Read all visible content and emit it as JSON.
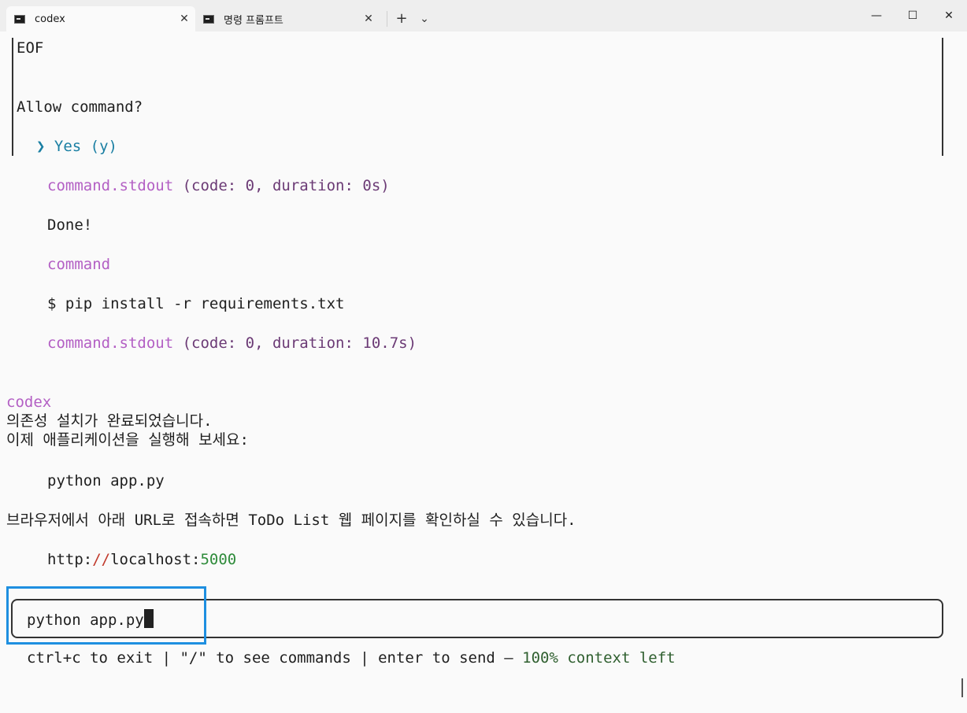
{
  "tabs": [
    {
      "title": "codex",
      "active": true
    },
    {
      "title": "명령 프롬프트",
      "active": false
    }
  ],
  "toolbar": {
    "new_tab": "+",
    "dropdown": "⌄"
  },
  "window_controls": {
    "minimize": "—",
    "maximize": "☐",
    "close": "✕"
  },
  "approval": {
    "eof": "EOF",
    "question": "Allow command?",
    "selected_option": "❯ Yes (y)"
  },
  "log": [
    {
      "label": "command.stdout",
      "detail": " (code: 0, duration: 0s)"
    },
    {
      "output": "Done!"
    },
    {
      "label": "command"
    },
    {
      "command": "$ pip install -r requirements.txt"
    },
    {
      "label": "command.stdout",
      "detail": " (code: 0, duration: 10.7s)"
    }
  ],
  "assistant": {
    "name": "codex",
    "line1": "의존성 설치가 완료되었습니다.",
    "line2": "이제 애플리케이션을 실행해 보세요:",
    "code": "python app.py",
    "line3": "브라우저에서 아래 URL로 접속하면 ToDo List 웹 페이지를 확인하실 수 있습니다.",
    "url": {
      "scheme": "http:",
      "slashes": "//",
      "host": "localhost:",
      "port": "5000"
    }
  },
  "input": {
    "value": "python app.py"
  },
  "footer": {
    "help": "ctrl+c to exit | \"/\" to see commands | enter to send — ",
    "context": "100% context left"
  },
  "colors": {
    "accent_purple": "#b35fc4",
    "highlight_blue": "#1e8fe0",
    "context_green": "#2f5f2f"
  }
}
